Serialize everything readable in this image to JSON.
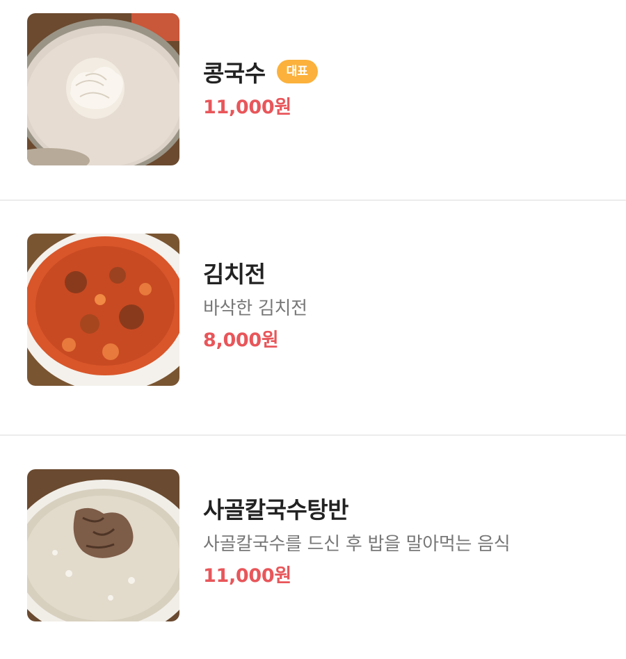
{
  "menu": {
    "items": [
      {
        "name": "콩국수",
        "badge": "대표",
        "description": "",
        "price": "11,000원",
        "image_icon": "kongguksu-photo"
      },
      {
        "name": "김치전",
        "badge": "",
        "description": "바삭한 김치전",
        "price": "8,000원",
        "image_icon": "kimchijeon-photo"
      },
      {
        "name": "사골칼국수탕반",
        "badge": "",
        "description": "사골칼국수를 드신 후 밥을 말아먹는 음식",
        "price": "11,000원",
        "image_icon": "sagol-kalguksu-photo"
      }
    ]
  },
  "colors": {
    "price": "#e8565a",
    "badge_bg": "#fbb13c",
    "name": "#222222",
    "description": "#777777",
    "divider": "#ececec"
  }
}
